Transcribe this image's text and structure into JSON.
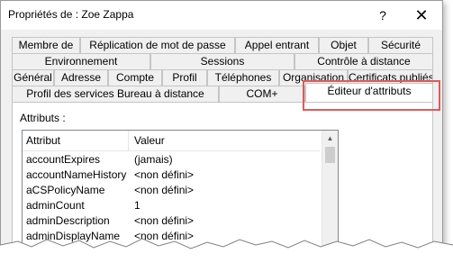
{
  "window": {
    "title": "Propriétés de : Zoe Zappa",
    "help_glyph": "?",
    "close_glyph": "✕"
  },
  "tabs": {
    "row1": [
      "Membre de",
      "Réplication de mot de passe",
      "Appel entrant",
      "Objet",
      "Sécurité"
    ],
    "row2": [
      "Environnement",
      "Sessions",
      "Contrôle à distance"
    ],
    "row3": [
      "Général",
      "Adresse",
      "Compte",
      "Profil",
      "Téléphones",
      "Organisation",
      "Certificats publiés"
    ],
    "row4": [
      "Profil des services Bureau à distance",
      "COM+",
      "Éditeur d'attributs"
    ]
  },
  "attributes": {
    "label": "Attributs :",
    "columns": [
      "Attribut",
      "Valeur"
    ],
    "rows": [
      [
        "accountExpires",
        "(jamais)"
      ],
      [
        "accountNameHistory",
        "<non défini>"
      ],
      [
        "aCSPolicyName",
        "<non défini>"
      ],
      [
        "adminCount",
        "1"
      ],
      [
        "adminDescription",
        "<non défini>"
      ],
      [
        "adminDisplayName",
        "<non défini>"
      ]
    ]
  },
  "highlight_color": "#e05a5a"
}
